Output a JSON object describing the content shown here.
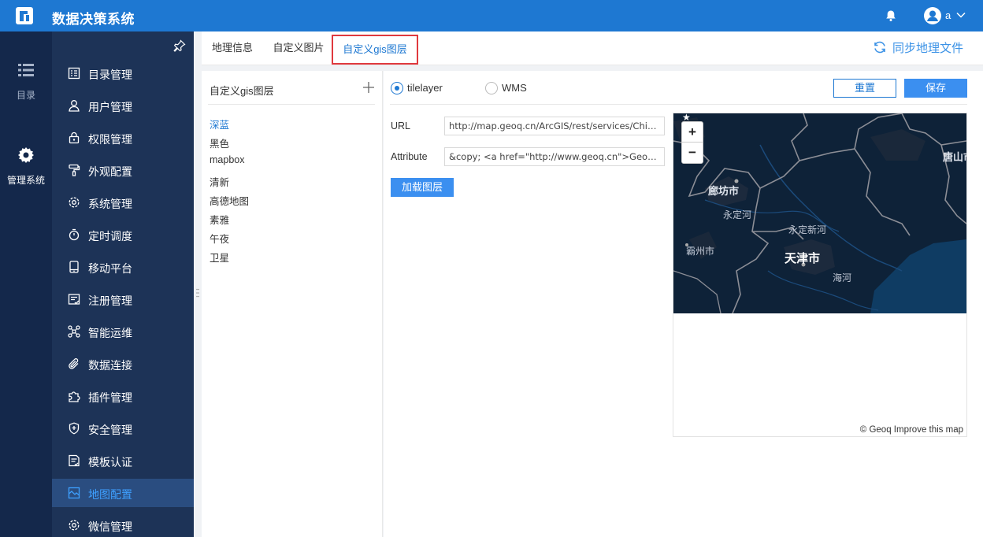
{
  "app": {
    "title": "数据决策系统",
    "user": "a"
  },
  "rail": [
    {
      "label": "目录",
      "icon": "list-icon"
    },
    {
      "label": "管理系统",
      "icon": "gear-icon"
    }
  ],
  "menu": [
    {
      "label": "目录管理",
      "icon": "catalog-icon"
    },
    {
      "label": "用户管理",
      "icon": "user-icon"
    },
    {
      "label": "权限管理",
      "icon": "lock-icon"
    },
    {
      "label": "外观配置",
      "icon": "paint-roller-icon"
    },
    {
      "label": "系统管理",
      "icon": "settings-icon"
    },
    {
      "label": "定时调度",
      "icon": "timer-icon"
    },
    {
      "label": "移动平台",
      "icon": "mobile-icon"
    },
    {
      "label": "注册管理",
      "icon": "register-icon"
    },
    {
      "label": "智能运维",
      "icon": "network-icon"
    },
    {
      "label": "数据连接",
      "icon": "attachment-icon"
    },
    {
      "label": "插件管理",
      "icon": "puzzle-icon"
    },
    {
      "label": "安全管理",
      "icon": "shield-icon"
    },
    {
      "label": "模板认证",
      "icon": "template-icon"
    },
    {
      "label": "地图配置",
      "icon": "map-icon",
      "active": true
    },
    {
      "label": "微信管理",
      "icon": "wechat-icon"
    }
  ],
  "tabs": [
    {
      "label": "地理信息"
    },
    {
      "label": "自定义图片"
    },
    {
      "label": "自定义gis图层",
      "active": true
    }
  ],
  "sync_label": "同步地理文件",
  "layers": {
    "header": "自定义gis图层",
    "items": [
      "深蓝",
      "黑色",
      "mapbox",
      "清新",
      "高德地图",
      "素雅",
      "午夜",
      "卫星"
    ],
    "selected": "深蓝"
  },
  "config": {
    "radio_tilelayer": "tilelayer",
    "radio_wms": "WMS",
    "selected_type": "tilelayer",
    "reset_label": "重置",
    "save_label": "保存",
    "url_label": "URL",
    "url_value": "http://map.geoq.cn/ArcGIS/rest/services/ChinaOnlineStreetPurplishBlue/MapServer/tile/{z}/{y}/{x}",
    "attr_label": "Attribute",
    "attr_value": "&copy; <a href=\"http://www.geoq.cn\">Geoq</a>",
    "load_label": "加载图层"
  },
  "map": {
    "zoom_in": "+",
    "zoom_out": "−",
    "attribution": "© Geoq Improve this map",
    "places": [
      "廊坊市",
      "永定河",
      "永定新河",
      "霸州市",
      "天津市",
      "海河",
      "唐山市"
    ]
  },
  "colors": {
    "primary": "#1e78d2",
    "header": "#1e78d2",
    "rail": "#14284b",
    "sidebar": "#1d3357",
    "map_bg": "#0e2238"
  }
}
